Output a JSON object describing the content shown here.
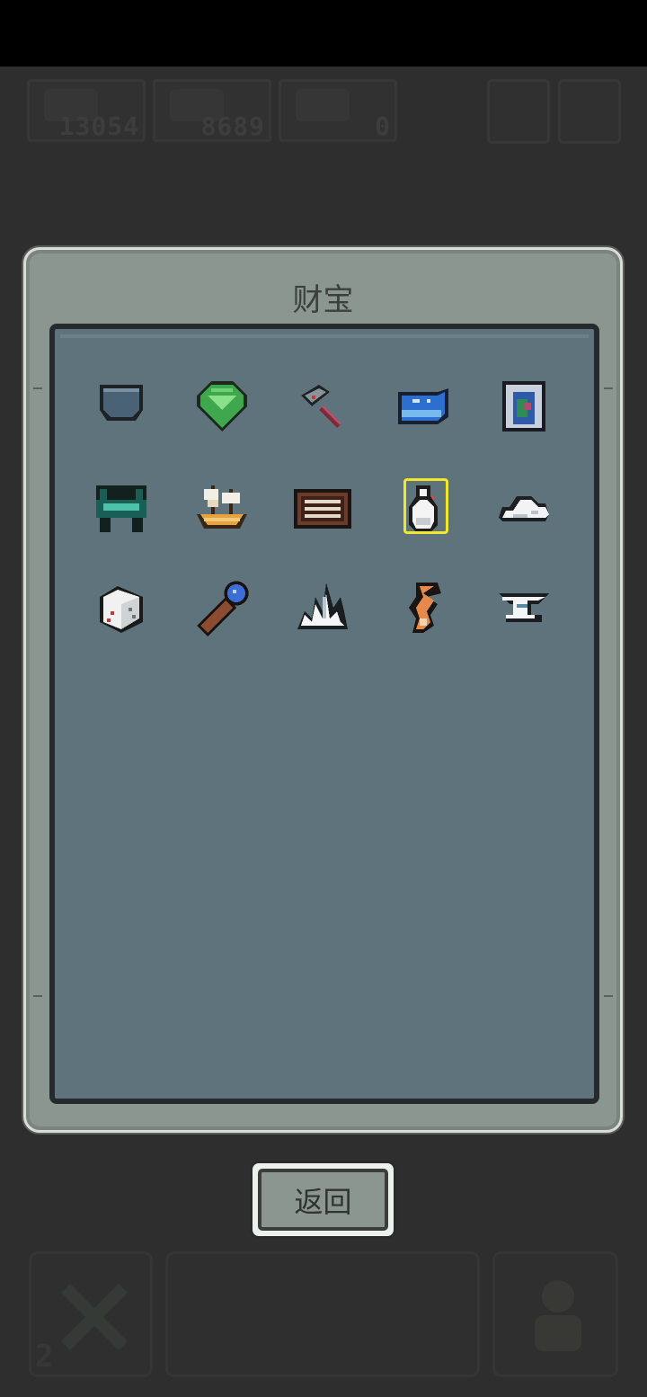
{
  "hud": {
    "resources": [
      {
        "name": "skull-resource-icon",
        "value": "13054"
      },
      {
        "name": "skull-ore-resource-icon",
        "value": "8689"
      },
      {
        "name": "chest-resource-icon",
        "value": "0"
      }
    ]
  },
  "dialog": {
    "title": "财宝",
    "items": [
      {
        "icon": "pocket-icon"
      },
      {
        "icon": "emerald-icon"
      },
      {
        "icon": "hammer-icon"
      },
      {
        "icon": "whale-icon"
      },
      {
        "icon": "portal-icon"
      },
      {
        "icon": "jade-table-icon"
      },
      {
        "icon": "sailing-ship-icon"
      },
      {
        "icon": "abacus-icon"
      },
      {
        "icon": "white-vase-icon",
        "selected": true
      },
      {
        "icon": "cloud-icon"
      },
      {
        "icon": "dice-icon"
      },
      {
        "icon": "telescope-icon"
      },
      {
        "icon": "crystal-cluster-icon"
      },
      {
        "icon": "fox-tail-icon"
      },
      {
        "icon": "anvil-icon"
      }
    ]
  },
  "back_button": {
    "label": "返回"
  },
  "bottom": {
    "left_count": "2"
  },
  "colors": {
    "panel": "#8c9690",
    "inner_panel": "#5e737c",
    "selection": "#f1e72c",
    "background": "#2e2e2e"
  }
}
